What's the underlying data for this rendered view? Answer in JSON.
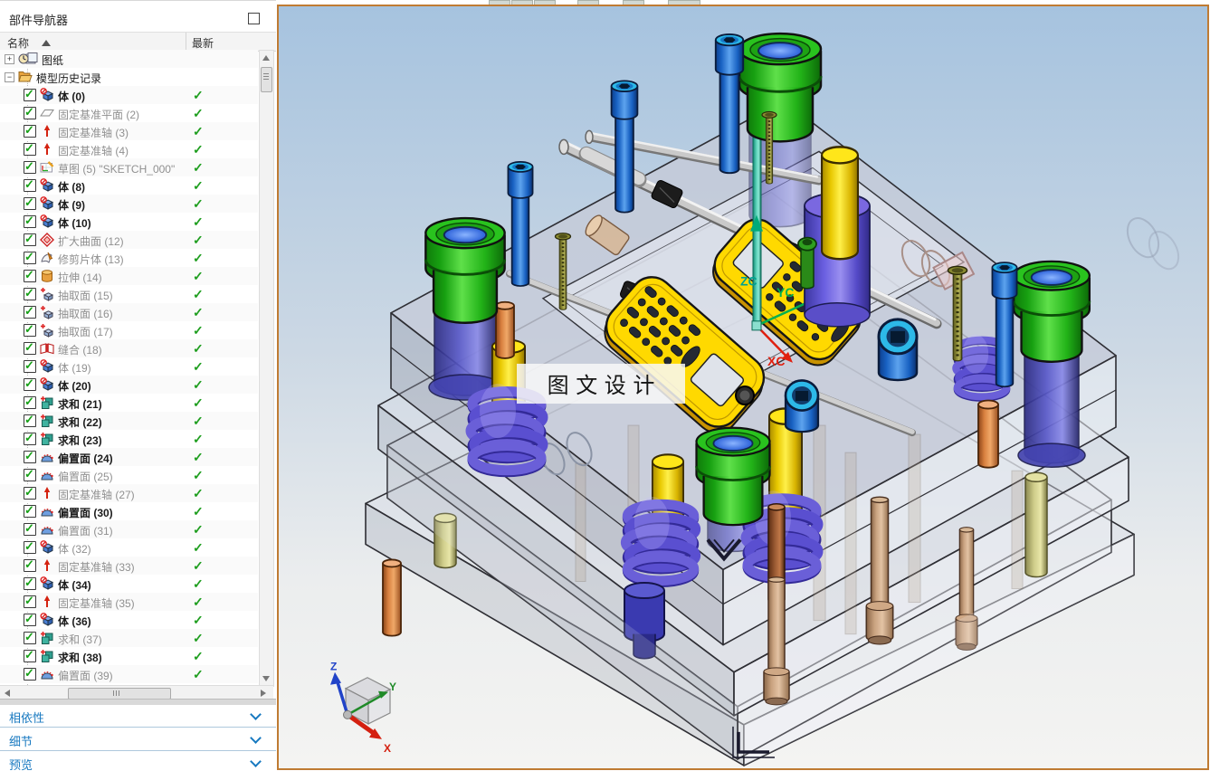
{
  "panel": {
    "title": "部件导航器",
    "columns": {
      "name": "名称",
      "status": "最新"
    },
    "tree": [
      {
        "label": "图纸",
        "icon": "drawing-icon",
        "expander": "plus",
        "level": 0,
        "checkbox": false,
        "status": false,
        "dim": false,
        "bold": false
      },
      {
        "label": "模型历史记录",
        "icon": "folder-icon",
        "expander": "minus",
        "level": 0,
        "checkbox": false,
        "status": false,
        "dim": false,
        "bold": false
      },
      {
        "label": "体 (0)",
        "icon": "body-icon",
        "expander": null,
        "level": 1,
        "checkbox": true,
        "status": true,
        "dim": false,
        "bold": true
      },
      {
        "label": "固定基准平面 (2)",
        "icon": "datum-plane-icon",
        "expander": null,
        "level": 1,
        "checkbox": true,
        "status": true,
        "dim": true,
        "bold": false
      },
      {
        "label": "固定基准轴 (3)",
        "icon": "datum-axis-icon",
        "expander": null,
        "level": 1,
        "checkbox": true,
        "status": true,
        "dim": true,
        "bold": false
      },
      {
        "label": "固定基准轴 (4)",
        "icon": "datum-axis-icon",
        "expander": null,
        "level": 1,
        "checkbox": true,
        "status": true,
        "dim": true,
        "bold": false
      },
      {
        "label": "草图 (5) \"SKETCH_000\"",
        "icon": "sketch-icon",
        "expander": null,
        "level": 1,
        "checkbox": true,
        "status": true,
        "dim": true,
        "bold": false
      },
      {
        "label": "体 (8)",
        "icon": "body-icon",
        "expander": null,
        "level": 1,
        "checkbox": true,
        "status": true,
        "dim": false,
        "bold": true
      },
      {
        "label": "体 (9)",
        "icon": "body-icon",
        "expander": null,
        "level": 1,
        "checkbox": true,
        "status": true,
        "dim": false,
        "bold": true
      },
      {
        "label": "体 (10)",
        "icon": "body-icon",
        "expander": null,
        "level": 1,
        "checkbox": true,
        "status": true,
        "dim": false,
        "bold": true
      },
      {
        "label": "扩大曲面 (12)",
        "icon": "enlarge-surface-icon",
        "expander": null,
        "level": 1,
        "checkbox": true,
        "status": true,
        "dim": true,
        "bold": false
      },
      {
        "label": "修剪片体 (13)",
        "icon": "trim-sheet-icon",
        "expander": null,
        "level": 1,
        "checkbox": true,
        "status": true,
        "dim": true,
        "bold": false
      },
      {
        "label": "拉伸 (14)",
        "icon": "extrude-icon",
        "expander": null,
        "level": 1,
        "checkbox": true,
        "status": true,
        "dim": true,
        "bold": false
      },
      {
        "label": "抽取面 (15)",
        "icon": "extract-face-icon",
        "expander": null,
        "level": 1,
        "checkbox": true,
        "status": true,
        "dim": true,
        "bold": false
      },
      {
        "label": "抽取面 (16)",
        "icon": "extract-face-icon",
        "expander": null,
        "level": 1,
        "checkbox": true,
        "status": true,
        "dim": true,
        "bold": false
      },
      {
        "label": "抽取面 (17)",
        "icon": "extract-face-icon",
        "expander": null,
        "level": 1,
        "checkbox": true,
        "status": true,
        "dim": true,
        "bold": false
      },
      {
        "label": "缝合 (18)",
        "icon": "sew-icon",
        "expander": null,
        "level": 1,
        "checkbox": true,
        "status": true,
        "dim": true,
        "bold": false
      },
      {
        "label": "体 (19)",
        "icon": "body-icon",
        "expander": null,
        "level": 1,
        "checkbox": true,
        "status": true,
        "dim": true,
        "bold": false
      },
      {
        "label": "体 (20)",
        "icon": "body-icon",
        "expander": null,
        "level": 1,
        "checkbox": true,
        "status": true,
        "dim": false,
        "bold": true
      },
      {
        "label": "求和 (21)",
        "icon": "unite-icon",
        "expander": null,
        "level": 1,
        "checkbox": true,
        "status": true,
        "dim": false,
        "bold": true
      },
      {
        "label": "求和 (22)",
        "icon": "unite-icon",
        "expander": null,
        "level": 1,
        "checkbox": true,
        "status": true,
        "dim": false,
        "bold": true
      },
      {
        "label": "求和 (23)",
        "icon": "unite-icon",
        "expander": null,
        "level": 1,
        "checkbox": true,
        "status": true,
        "dim": false,
        "bold": true
      },
      {
        "label": "偏置面 (24)",
        "icon": "offset-face-icon",
        "expander": null,
        "level": 1,
        "checkbox": true,
        "status": true,
        "dim": false,
        "bold": true
      },
      {
        "label": "偏置面 (25)",
        "icon": "offset-face-icon",
        "expander": null,
        "level": 1,
        "checkbox": true,
        "status": true,
        "dim": true,
        "bold": false
      },
      {
        "label": "固定基准轴 (27)",
        "icon": "datum-axis-icon",
        "expander": null,
        "level": 1,
        "checkbox": true,
        "status": true,
        "dim": true,
        "bold": false
      },
      {
        "label": "偏置面 (30)",
        "icon": "offset-face-icon",
        "expander": null,
        "level": 1,
        "checkbox": true,
        "status": true,
        "dim": false,
        "bold": true
      },
      {
        "label": "偏置面 (31)",
        "icon": "offset-face-icon",
        "expander": null,
        "level": 1,
        "checkbox": true,
        "status": true,
        "dim": true,
        "bold": false
      },
      {
        "label": "体 (32)",
        "icon": "body-icon",
        "expander": null,
        "level": 1,
        "checkbox": true,
        "status": true,
        "dim": true,
        "bold": false
      },
      {
        "label": "固定基准轴 (33)",
        "icon": "datum-axis-icon",
        "expander": null,
        "level": 1,
        "checkbox": true,
        "status": true,
        "dim": true,
        "bold": false
      },
      {
        "label": "体 (34)",
        "icon": "body-icon",
        "expander": null,
        "level": 1,
        "checkbox": true,
        "status": true,
        "dim": false,
        "bold": true
      },
      {
        "label": "固定基准轴 (35)",
        "icon": "datum-axis-icon",
        "expander": null,
        "level": 1,
        "checkbox": true,
        "status": true,
        "dim": true,
        "bold": false
      },
      {
        "label": "体 (36)",
        "icon": "body-icon",
        "expander": null,
        "level": 1,
        "checkbox": true,
        "status": true,
        "dim": false,
        "bold": true
      },
      {
        "label": "求和 (37)",
        "icon": "unite-icon",
        "expander": null,
        "level": 1,
        "checkbox": true,
        "status": true,
        "dim": true,
        "bold": false
      },
      {
        "label": "求和 (38)",
        "icon": "unite-icon",
        "expander": null,
        "level": 1,
        "checkbox": true,
        "status": true,
        "dim": false,
        "bold": true
      },
      {
        "label": "偏置面 (39)",
        "icon": "offset-face-icon",
        "expander": null,
        "level": 1,
        "checkbox": true,
        "status": true,
        "dim": true,
        "bold": false
      }
    ],
    "sections": [
      {
        "label": "相依性"
      },
      {
        "label": "细节"
      },
      {
        "label": "预览"
      }
    ]
  },
  "viewport": {
    "watermark": "图 文 设 计",
    "wcs": {
      "x": "XC",
      "y": "YC",
      "z": "ZC"
    },
    "triad": {
      "x": "X",
      "y": "Y",
      "z": "Z"
    },
    "colors": {
      "viewport_border": "#bf7b33",
      "bg_top": "#a6c3df",
      "bg_bottom": "#f4f4f2",
      "bushing_green": "#2ec21f",
      "bore_blue": "#3a6fe8",
      "screw_blue": "#1f6fd0",
      "screw_rim": "#45c8f0",
      "spring_purple": "#5a4fd0",
      "part_yellow": "#ffd900",
      "pin_tan": "#c9ab93",
      "pin_orange": "#d8803f",
      "check_green": "#1f9e1f",
      "section_blue": "#1879c0",
      "wcs_green": "#00aa7a",
      "wcs_red": "#e02010"
    }
  }
}
